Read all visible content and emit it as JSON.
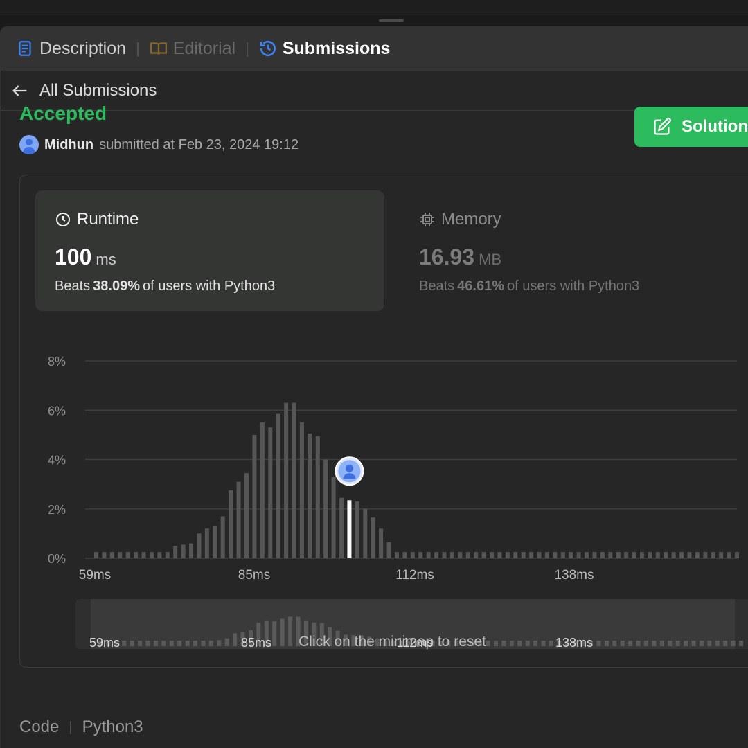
{
  "tabs": {
    "description": "Description",
    "editorial": "Editorial",
    "submissions": "Submissions"
  },
  "nav": {
    "back_label": "All Submissions"
  },
  "submission": {
    "status": "Accepted",
    "user": "Midhun",
    "submitted_text": "submitted at Feb 23, 2024 19:12"
  },
  "solution_button": {
    "label": "Solution"
  },
  "runtime": {
    "title": "Runtime",
    "value": "100",
    "unit": "ms",
    "beats_prefix": "Beats",
    "beats_pct": "38.09%",
    "beats_suffix": "of users with Python3"
  },
  "memory": {
    "title": "Memory",
    "value": "16.93",
    "unit": "MB",
    "beats_prefix": "Beats",
    "beats_pct": "46.61%",
    "beats_suffix": "of users with Python3"
  },
  "chart_hint": "Click on the minimap to reset",
  "code_section": {
    "label": "Code",
    "language": "Python3"
  },
  "colors": {
    "accent_green": "#2cbb5d",
    "bar": "#565656",
    "highlight_bar": "#ffffff",
    "grid": "#3e3e3e",
    "tab_active_icon": "#3b82f6"
  },
  "chart_data": {
    "type": "bar",
    "title": "",
    "xlabel": "",
    "ylabel": "",
    "x_tick_labels": [
      "59ms",
      "85ms",
      "112ms",
      "138ms"
    ],
    "y_tick_labels": [
      "0%",
      "2%",
      "4%",
      "6%",
      "8%"
    ],
    "ylim": [
      0,
      8
    ],
    "highlight_index": 32,
    "highlight_value_ms": 100,
    "values": [
      0.25,
      0.25,
      0.25,
      0.25,
      0.25,
      0.25,
      0.25,
      0.25,
      0.25,
      0.25,
      0.5,
      0.55,
      0.6,
      1.0,
      1.2,
      1.3,
      1.7,
      2.75,
      3.1,
      3.45,
      5.0,
      5.5,
      5.3,
      5.85,
      6.3,
      6.3,
      5.5,
      5.05,
      4.95,
      4.0,
      3.3,
      2.45,
      2.35,
      2.3,
      2.0,
      1.65,
      1.2,
      0.65,
      0.25,
      0.25,
      0.25,
      0.25,
      0.25,
      0.25,
      0.25,
      0.25,
      0.25,
      0.25,
      0.25,
      0.25,
      0.25,
      0.25,
      0.25,
      0.25,
      0.25,
      0.25,
      0.25,
      0.25,
      0.25,
      0.25,
      0.25,
      0.25,
      0.25,
      0.25,
      0.25,
      0.25,
      0.25,
      0.25,
      0.25,
      0.25,
      0.25,
      0.25,
      0.25,
      0.25,
      0.25,
      0.25,
      0.25,
      0.25,
      0.25,
      0.25,
      0.25,
      0.25
    ],
    "grid": true,
    "minimap": true
  }
}
